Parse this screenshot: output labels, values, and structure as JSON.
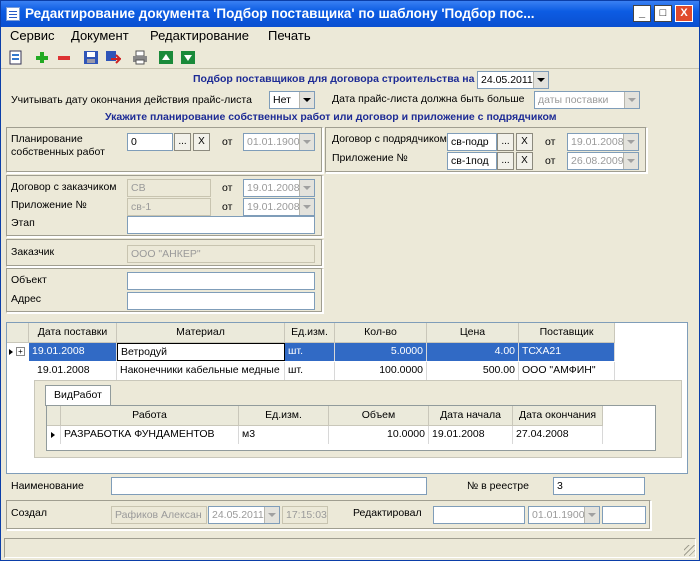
{
  "window": {
    "title": "Редактирование документа 'Подбор поставщика' по шаблону 'Подбор пос...",
    "btn_min": "_",
    "btn_max": "□",
    "btn_close": "X"
  },
  "menu": [
    "Сервис",
    "Документ",
    "Редактирование",
    "Печать"
  ],
  "header": {
    "title": "Подбор поставщиков для договора строительства на",
    "date": "24.05.2011"
  },
  "pricelist": {
    "label": "Учитывать дату окончания действия прайс-листа",
    "value": "Нет",
    "date_label": "Дата прайс-листа должна быть больше",
    "date_value": "даты поставки"
  },
  "hint": "Укажите планирование собственных работ или договор и приложение с подрядчиком",
  "planning": {
    "label1": "Планирование",
    "label2": "собственных работ",
    "value": "0",
    "btn": "...",
    "x": "X",
    "from": "от",
    "date": "01.01.1900"
  },
  "contractor": {
    "contract_label": "Договор с подрядчиком",
    "contract_value": "св-подр",
    "appendix_label": "Приложение №",
    "appendix_value": "св-1под",
    "btn": "...",
    "x": "X",
    "from": "от",
    "contract_date": "19.01.2008",
    "appendix_date": "26.08.2009"
  },
  "customer_contract": {
    "label": "Договор с заказчиком",
    "value": "СВ",
    "from": "от",
    "date": "19.01.2008",
    "appendix_label": "Приложение №",
    "appendix_value": "св-1",
    "appendix_date": "19.01.2008",
    "stage_label": "Этап",
    "stage_value": ""
  },
  "customer": {
    "label": "Заказчик",
    "value": "ООО \"АНКЕР\""
  },
  "object": {
    "label": "Объект",
    "value": "",
    "address_label": "Адрес",
    "address_value": ""
  },
  "grid": {
    "headers": [
      "Дата поставки",
      "Материал",
      "Ед.изм.",
      "Кол-во",
      "Цена",
      "Поставщик"
    ],
    "rows": [
      {
        "date": "19.01.2008",
        "material": "Ветродуй",
        "unit": "шт.",
        "qty": "5.0000",
        "price": "4.00",
        "supplier": "ТСХА21"
      },
      {
        "date": "19.01.2008",
        "material": "Наконечники кабельные медные",
        "unit": "шт.",
        "qty": "100.0000",
        "price": "500.00",
        "supplier": "ООО \"АМФИН\""
      }
    ],
    "detail_tab": "ВидРабот",
    "detail_headers": [
      "Работа",
      "Ед.изм.",
      "Объем",
      "Дата начала",
      "Дата окончания"
    ],
    "detail_rows": [
      {
        "work": "РАЗРАБОТКА ФУНДАМЕНТОВ",
        "unit": "м3",
        "volume": "10.0000",
        "start": "19.01.2008",
        "end": "27.04.2008"
      }
    ]
  },
  "footer": {
    "name_label": "Наименование",
    "name_value": "",
    "registry_label": "№ в реестре",
    "registry_value": "3",
    "created_label": "Создал",
    "created_by": "Рафиков Алексан",
    "created_date": "24.05.2011",
    "created_time": "17:15:03",
    "edited_label": "Редактировал",
    "edited_by": "",
    "edited_date": "01.01.1900",
    "edited_time": ""
  },
  "colors": {
    "title_bar": "#0a4fd0",
    "selection": "#316ac5",
    "section_text": "#1d2b95"
  }
}
